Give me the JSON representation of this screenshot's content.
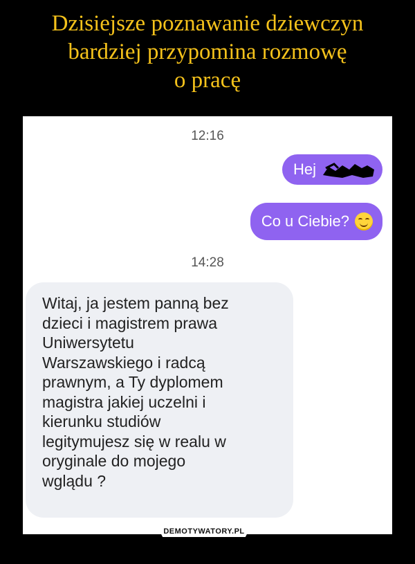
{
  "caption": {
    "line1": "Dzisiejsze poznawanie dziewczyn",
    "line2": "bardziej przypomina rozmowę",
    "line3": "o pracę"
  },
  "chat": {
    "time1": "12:16",
    "outgoing": [
      {
        "text": "Hej",
        "redacted": true
      },
      {
        "text": "Co u Ciebie?",
        "emoji": "smiling-face-icon"
      }
    ],
    "time2": "14:28",
    "incoming": "Witaj, ja jestem panną bez\ndzieci i magistrem prawa\nUniwersytetu\nWarszawskiego i radcą\nprawnym, a Ty dyplomem\nmagistra jakiej uczelni i\nkierunku  studiów\nlegitymujesz się w realu w\noryginale do mojego\nwglądu ?"
  },
  "watermark": "DEMOTYWATORY.PL",
  "colors": {
    "caption": "#f5c21b",
    "outgoing_bubble": "#8f63f0",
    "incoming_bubble": "#eef0f4"
  }
}
